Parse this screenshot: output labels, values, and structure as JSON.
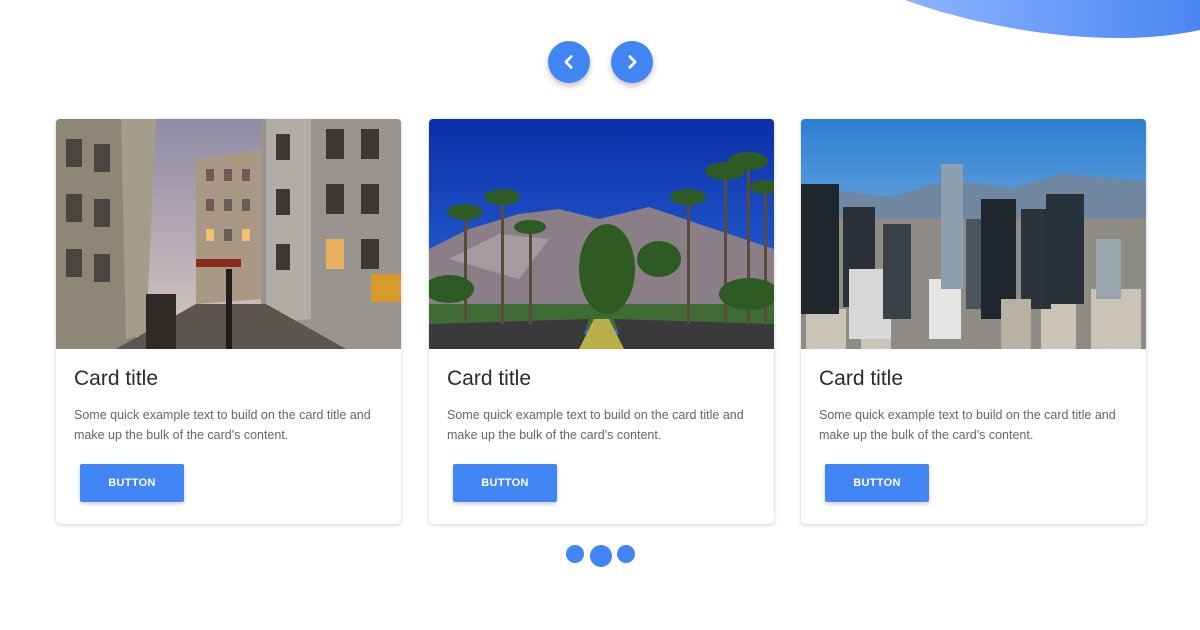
{
  "colors": {
    "accent": "#4285f4"
  },
  "carousel": {
    "prev_icon": "chevron-left-icon",
    "next_icon": "chevron-right-icon",
    "cards": [
      {
        "image": "city-street-photo",
        "title": "Card title",
        "text": "Some quick example text to build on the card title and make up the bulk of the card's content.",
        "button_label": "BUTTON"
      },
      {
        "image": "palm-road-photo",
        "title": "Card title",
        "text": "Some quick example text to build on the card title and make up the bulk of the card's content.",
        "button_label": "BUTTON"
      },
      {
        "image": "skyline-photo",
        "title": "Card title",
        "text": "Some quick example text to build on the card title and make up the bulk of the card's content.",
        "button_label": "BUTTON"
      }
    ],
    "indicators": {
      "count": 3,
      "active": 1
    }
  }
}
